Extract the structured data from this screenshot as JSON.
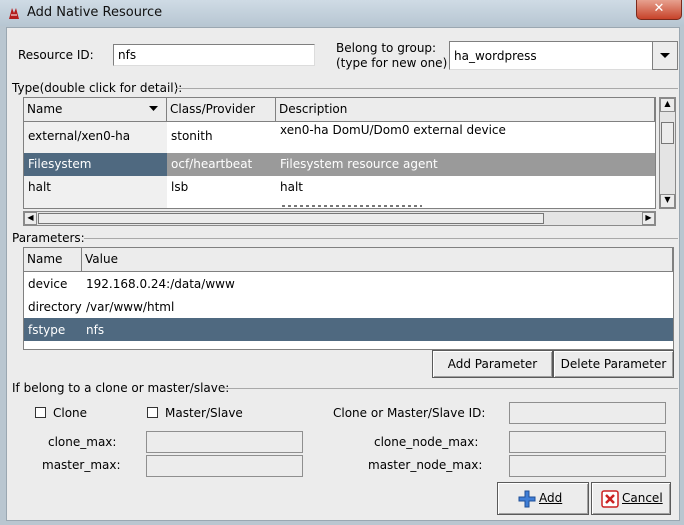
{
  "window": {
    "title": "Add Native Resource",
    "close_symbol": "✕"
  },
  "form": {
    "resource_id_label": "Resource ID:",
    "resource_id_value": "nfs",
    "group_label_line1": "Belong to group:",
    "group_label_line2": "(type for new one)",
    "group_value": "ha_wordpress"
  },
  "types": {
    "section_label": "Type(double click for detail):",
    "columns": [
      "Name",
      "Class/Provider",
      "Description"
    ],
    "rows": [
      {
        "name": "external/xen0-ha",
        "provider": "stonith",
        "description": "xen0-ha DomU/Dom0 external device"
      },
      {
        "name": "Filesystem",
        "provider": "ocf/heartbeat",
        "description": "Filesystem resource agent"
      },
      {
        "name": "halt",
        "provider": "lsb",
        "description": "halt"
      }
    ]
  },
  "parameters": {
    "section_label": "Parameters:",
    "columns": [
      "Name",
      "Value"
    ],
    "rows": [
      {
        "name": "device",
        "value": "192.168.0.24:/data/www"
      },
      {
        "name": "directory",
        "value": "/var/www/html"
      },
      {
        "name": "fstype",
        "value": "nfs"
      }
    ],
    "add_button": "Add Parameter",
    "delete_button": "Delete Parameter"
  },
  "clone": {
    "section_label": "If belong to a clone or master/slave:",
    "clone_checkbox": "Clone",
    "master_slave_checkbox": "Master/Slave",
    "id_label": "Clone or Master/Slave ID:",
    "clone_max_label": "clone_max:",
    "master_max_label": "master_max:",
    "clone_node_max_label": "clone_node_max:",
    "master_node_max_label": "master_node_max:"
  },
  "buttons": {
    "add": "Add",
    "cancel": "Cancel"
  },
  "colors": {
    "selection": "#4f6980",
    "selection_inactive": "#9a9a9a",
    "dialog_bg": "#ececec"
  }
}
